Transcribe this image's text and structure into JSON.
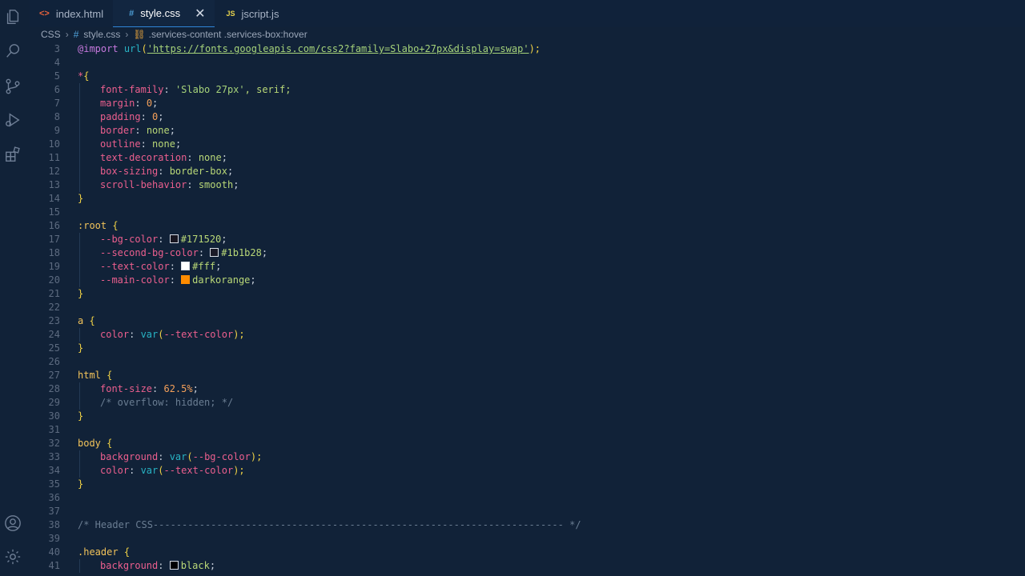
{
  "tabs": [
    {
      "label": "index.html",
      "icon": "<>",
      "icon_color": "#e8623c",
      "active": false
    },
    {
      "label": "style.css",
      "icon": "#",
      "icon_color": "#4ea0d8",
      "active": true,
      "close": "✕"
    },
    {
      "label": "jscript.js",
      "icon": "JS",
      "icon_color": "#e8d44d",
      "active": false
    }
  ],
  "breadcrumb": {
    "lang": "CSS",
    "file": "style.css",
    "selector": ".services-content .services-box:hover"
  },
  "colors": {
    "swatch_bg": "#171520",
    "swatch_second_bg": "#1b1b28",
    "swatch_text": "#ffffff",
    "swatch_main": "#ff8c00",
    "swatch_black": "#000000"
  },
  "editor": {
    "line_numbers": [
      "3",
      "4",
      "5",
      "6",
      "7",
      "8",
      "9",
      "10",
      "11",
      "12",
      "13",
      "14",
      "15",
      "16",
      "17",
      "18",
      "19",
      "20",
      "21",
      "22",
      "23",
      "24",
      "25",
      "26",
      "27",
      "28",
      "29",
      "30",
      "31",
      "32",
      "33",
      "34",
      "35",
      "36",
      "37",
      "38",
      "39",
      "40",
      "41"
    ],
    "l3": {
      "at": "@import",
      "fn": "url",
      "open": "(",
      "str": "'https://fonts.googleapis.com/css2?family=Slabo+27px&display=swap'",
      "close": ");"
    },
    "l5": {
      "sel": "*",
      "brace": "{"
    },
    "l6": {
      "prop": "font-family",
      "colon": ": ",
      "val": "'Slabo 27px'",
      "rest": ", serif;"
    },
    "l7": {
      "prop": "margin",
      "colon": ": ",
      "num": "0",
      "semi": ";"
    },
    "l8": {
      "prop": "padding",
      "colon": ": ",
      "num": "0",
      "semi": ";"
    },
    "l9": {
      "prop": "border",
      "colon": ": ",
      "val": "none",
      "semi": ";"
    },
    "l10": {
      "prop": "outline",
      "colon": ": ",
      "val": "none",
      "semi": ";"
    },
    "l11": {
      "prop": "text-decoration",
      "colon": ": ",
      "val": "none",
      "semi": ";"
    },
    "l12": {
      "prop": "box-sizing",
      "colon": ": ",
      "val": "border-box",
      "semi": ";"
    },
    "l13": {
      "prop": "scroll-behavior",
      "colon": ": ",
      "val": "smooth",
      "semi": ";"
    },
    "close_brace": "}",
    "l16": {
      "sel": ":root",
      "brace": "{"
    },
    "l17": {
      "prop": "--bg-color",
      "colon": ": ",
      "val": "#171520",
      "semi": ";"
    },
    "l18": {
      "prop": "--second-bg-color",
      "colon": ": ",
      "val": "#1b1b28",
      "semi": ";"
    },
    "l19": {
      "prop": "--text-color",
      "colon": ": ",
      "val": "#fff",
      "semi": ";"
    },
    "l20": {
      "prop": "--main-color",
      "colon": ": ",
      "val": "darkorange",
      "semi": ";"
    },
    "l23": {
      "sel": "a",
      "brace": "{"
    },
    "l24": {
      "prop": "color",
      "colon": ": ",
      "fn": "var",
      "open": "(",
      "var": "--text-color",
      "close": ");"
    },
    "l27": {
      "sel": "html",
      "brace": "{"
    },
    "l28": {
      "prop": "font-size",
      "colon": ": ",
      "num": "62.5%",
      "semi": ";"
    },
    "l29": {
      "comment": "/* overflow: hidden; */"
    },
    "l32": {
      "sel": "body",
      "brace": "{"
    },
    "l33": {
      "prop": "background",
      "colon": ": ",
      "fn": "var",
      "open": "(",
      "var": "--bg-color",
      "close": ");"
    },
    "l34": {
      "prop": "color",
      "colon": ": ",
      "fn": "var",
      "open": "(",
      "var": "--text-color",
      "close": ");"
    },
    "l38": {
      "comment": "/* Header CSS----------------------------------------------------------------------- */"
    },
    "l40": {
      "sel": ".header",
      "brace": "{"
    },
    "l41": {
      "prop": "background",
      "colon": ": ",
      "val": "black",
      "semi": ";"
    }
  }
}
